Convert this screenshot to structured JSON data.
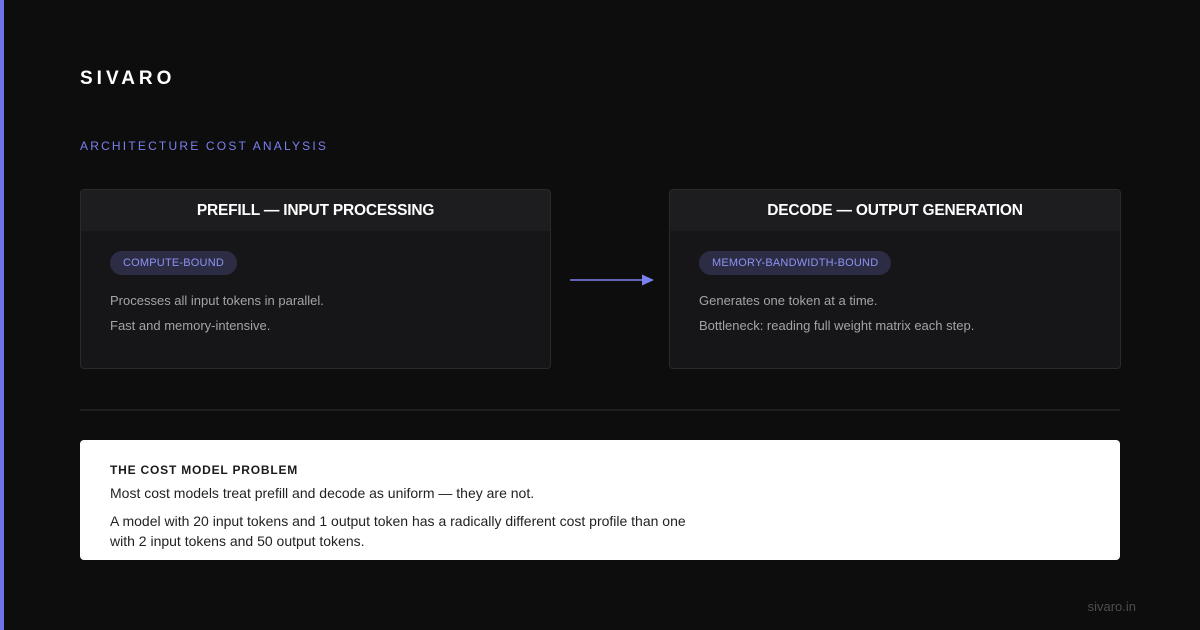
{
  "brand": "SIVARO",
  "section_label": "ARCHITECTURE COST ANALYSIS",
  "cards": [
    {
      "title": "PREFILL — INPUT PROCESSING",
      "badge": "COMPUTE-BOUND",
      "lines": [
        "Processes all input tokens in parallel.",
        "Fast and memory-intensive."
      ]
    },
    {
      "title": "DECODE — OUTPUT GENERATION",
      "badge": "MEMORY-BANDWIDTH-BOUND",
      "lines": [
        "Generates one token at a time.",
        "Bottleneck: reading full weight matrix each step."
      ]
    }
  ],
  "flow_icon": "arrow-right-icon",
  "problem": {
    "title": "THE COST MODEL PROBLEM",
    "lead": "Most cost models treat prefill and decode as uniform — they are not.",
    "detail": "A model with 20 input tokens and 1 output token has a radically different cost profile than one with 2 input tokens and 50 output tokens."
  },
  "footer": "sivaro.in",
  "colors": {
    "accent": "#6f73e8",
    "background": "#0d0d0d",
    "card": "#161618",
    "badge_bg": "#2c2d45",
    "badge_text": "#8d92f2"
  }
}
